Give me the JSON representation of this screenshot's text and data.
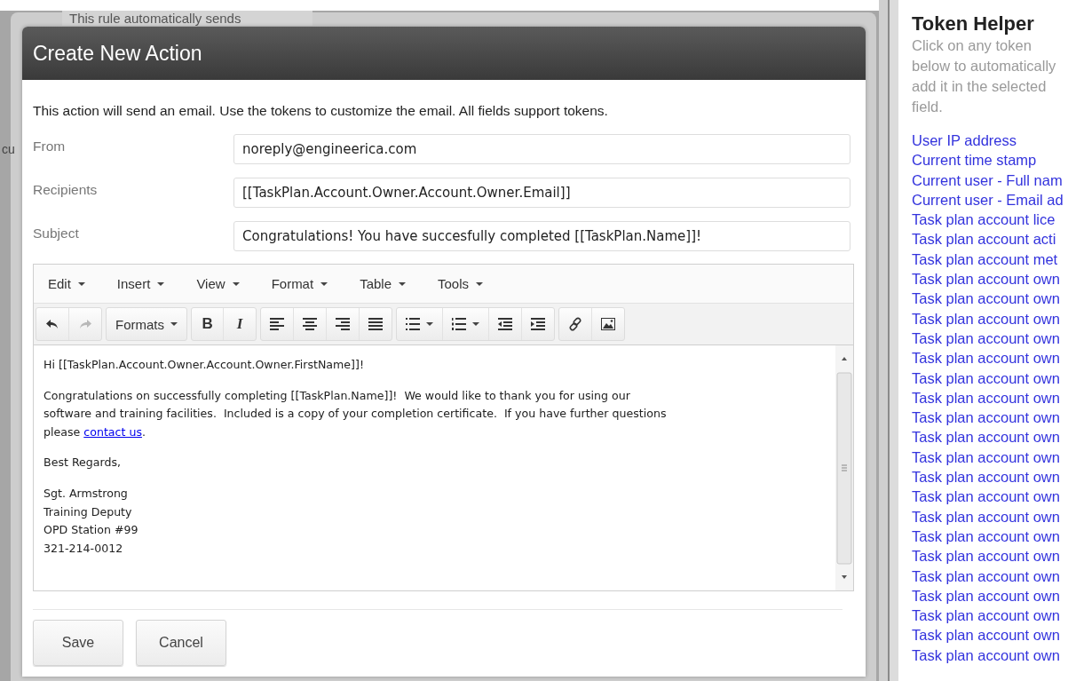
{
  "background": {
    "texts": [
      "This rule automatically sends",
      "cu"
    ]
  },
  "dialog": {
    "title": "Create New Action",
    "description": "This action will send an email. Use the tokens to customize the email. All fields support tokens.",
    "fields": [
      {
        "label": "From",
        "value": "noreply@engineerica.com"
      },
      {
        "label": "Recipients",
        "value": "[[TaskPlan.Account.Owner.Account.Owner.Email]]"
      },
      {
        "label": "Subject",
        "value": "Congratulations! You have succesfully completed [[TaskPlan.Name]]!"
      }
    ],
    "editor": {
      "menus": [
        "Edit",
        "Insert",
        "View",
        "Format",
        "Table",
        "Tools"
      ],
      "toolbar": [
        [
          {
            "kind": "undo",
            "disabled": false
          },
          {
            "kind": "redo",
            "disabled": true
          }
        ],
        [
          {
            "kind": "formats",
            "label": "Formats",
            "disabled": false
          }
        ],
        [
          {
            "kind": "bold",
            "label": "B",
            "disabled": false
          },
          {
            "kind": "italic",
            "label": "I",
            "disabled": false
          }
        ],
        [
          {
            "kind": "align-left",
            "disabled": false
          },
          {
            "kind": "align-center",
            "disabled": false
          },
          {
            "kind": "align-right",
            "disabled": false
          },
          {
            "kind": "justify",
            "disabled": false
          }
        ],
        [
          {
            "kind": "bullet-list",
            "disabled": false
          },
          {
            "kind": "numbered-list",
            "disabled": false
          },
          {
            "kind": "outdent",
            "disabled": false
          },
          {
            "kind": "indent",
            "disabled": false
          }
        ],
        [
          {
            "kind": "link",
            "disabled": false
          },
          {
            "kind": "image",
            "disabled": false
          }
        ]
      ],
      "paragraphs": [
        {
          "lines": [
            "Hi [[TaskPlan.Account.Owner.Account.Owner.FirstName]]!"
          ]
        },
        {
          "lines": [
            "Congratulations on successfully completing [[TaskPlan.Name]]!  We would like to thank you for using our",
            "software and training facilities.  Included is a copy of your completion certificate.  If you have further questions",
            "please "
          ],
          "link": "contact us",
          "link_suffix": "."
        },
        {
          "lines": [
            "Best Regards,"
          ]
        },
        {
          "lines": [
            "Sgt. Armstrong",
            "Training Deputy",
            "OPD Station #99",
            "321-214-0012"
          ]
        }
      ]
    },
    "buttons": [
      "Save",
      "Cancel"
    ]
  },
  "token_helper": {
    "title": "Token Helper",
    "description": "Click on any token below to automatically add it in the selected field.",
    "tokens": [
      "User IP address",
      "Current time stamp",
      "Current user - Full nam",
      "Current user - Email ad",
      "Task plan account lice",
      "Task plan account acti",
      "Task plan account met",
      "Task plan account own",
      "Task plan account own",
      "Task plan account own",
      "Task plan account own",
      "Task plan account own",
      "Task plan account own",
      "Task plan account own",
      "Task plan account own",
      "Task plan account own",
      "Task plan account own",
      "Task plan account own",
      "Task plan account own",
      "Task plan account own",
      "Task plan account own",
      "Task plan account own",
      "Task plan account own",
      "Task plan account own",
      "Task plan account own",
      "Task plan account own",
      "Task plan account own"
    ]
  }
}
